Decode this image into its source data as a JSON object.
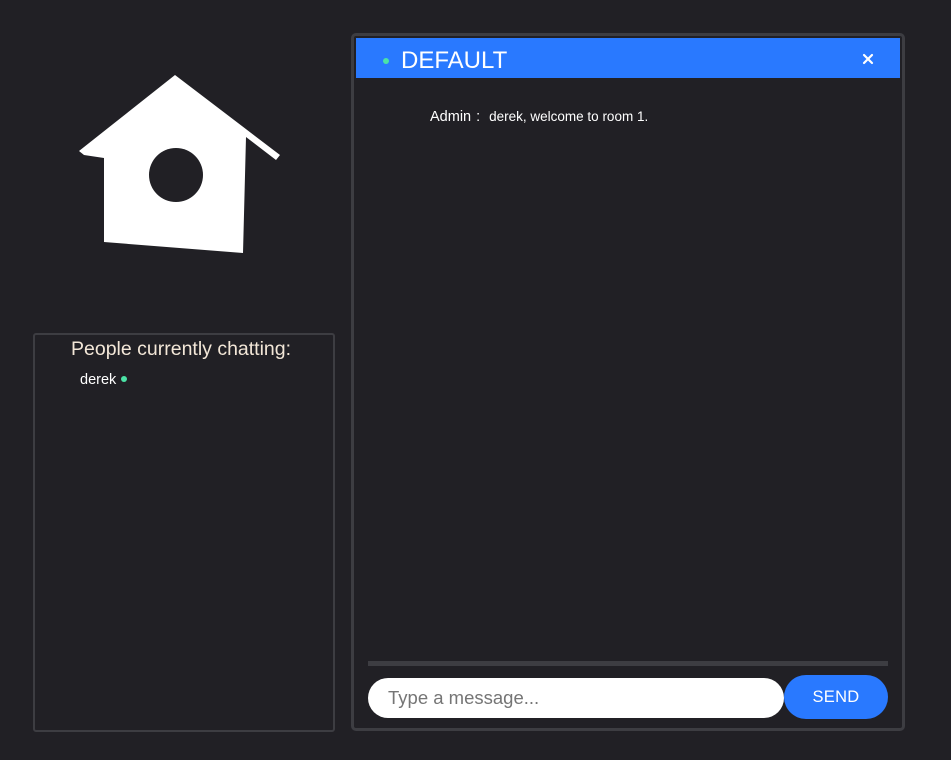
{
  "colors": {
    "background": "#212025",
    "panel_border": "#3d3d42",
    "accent": "#2979ff",
    "online_dot": "#4be3a6",
    "heading_text": "#f3e7d8",
    "input_bg": "#ffffff"
  },
  "logo": {
    "icon": "birdhouse-icon"
  },
  "people": {
    "heading": "People currently chatting:",
    "users": [
      {
        "name": "derek",
        "status": "online"
      }
    ]
  },
  "chat": {
    "room_name": "DEFAULT",
    "close_icon": "close-icon",
    "status_icon": "online-dot-icon",
    "messages": [
      {
        "sender": "Admin",
        "separator": ":",
        "text": "derek, welcome to room 1."
      }
    ],
    "input": {
      "value": "",
      "placeholder": "Type a message..."
    },
    "send_label": "SEND"
  }
}
